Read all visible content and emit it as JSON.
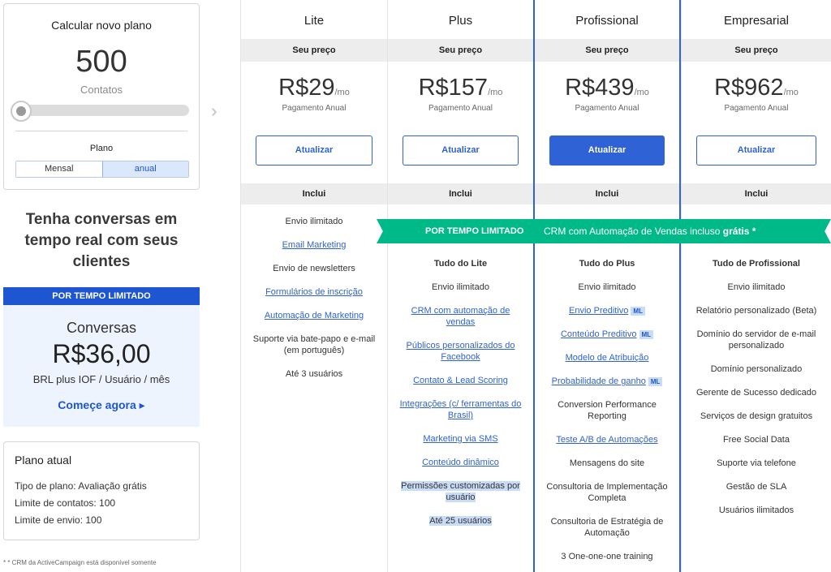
{
  "calculator": {
    "title": "Calcular novo plano",
    "contacts_value": "500",
    "contacts_unit": "Contatos",
    "slider_level": 0,
    "plan_label": "Plano",
    "toggle": {
      "monthly": "Mensal",
      "annual": "anual",
      "selected": "annual"
    }
  },
  "arrow_icon": "double-chevron-right",
  "promo": {
    "heading": "Tenha conversas em tempo real com seus clientes",
    "banner": "POR TEMPO LIMITADO",
    "title": "Conversas",
    "price": "R$36,00",
    "subtitle": "BRL plus IOF / Usuário / mês",
    "cta": "Começe agora ▸"
  },
  "current_plan": {
    "title": "Plano atual",
    "type": "Tipo de plano: Avaliação grátis",
    "contact_limit": "Limite de contatos: 100",
    "send_limit": "Limite de envio: 100"
  },
  "footnote": "* * CRM da ActiveCampaign está disponível somente",
  "ribbon": {
    "tag": "POR TEMPO LIMITADO",
    "text": "CRM com Automação de Vendas incluso ",
    "free": "grátis *",
    "color": "#00b989"
  },
  "colors": {
    "accent": "#2f62d4",
    "ribbon": "#00b989",
    "promo_bg": "#eef4fd"
  },
  "plans": [
    {
      "name": "Lite",
      "price_header": "Seu preço",
      "price": "R$29",
      "period": "/mo",
      "billing": "Pagamento Anual",
      "button": "Atualizar",
      "includes": "Inclui",
      "features": [
        {
          "text": "Envio ilimitado"
        },
        {
          "text": "Email Marketing",
          "link": true
        },
        {
          "text": "Envio de newsletters"
        },
        {
          "text": "Formulários de inscrição",
          "link": true
        },
        {
          "text": "Automação de Marketing",
          "link": true
        },
        {
          "text": "Suporte via bate-papo e e-mail (em português)"
        },
        {
          "text": "Até 3 usuários"
        }
      ]
    },
    {
      "name": "Plus",
      "price_header": "Seu preço",
      "price": "R$157",
      "period": "/mo",
      "billing": "Pagamento Anual",
      "button": "Atualizar",
      "includes": "Inclui",
      "features": [
        {
          "text": "Tudo do Lite",
          "bold": true
        },
        {
          "text": "Envio ilimitado"
        },
        {
          "text": "CRM com automação de vendas",
          "link": true
        },
        {
          "text": "Públicos personalizados do Facebook",
          "link": true
        },
        {
          "text": "Contato & Lead Scoring",
          "link": true
        },
        {
          "text": "Integrações (c/ ferramentas do Brasil)",
          "link": true
        },
        {
          "text": "Marketing via SMS",
          "link": true
        },
        {
          "text": "Conteúdo dinâmico",
          "link": true
        },
        {
          "text": "Permissões customizadas por usuário",
          "highlight": true
        },
        {
          "text": "Até 25 usuários",
          "highlight": true
        }
      ]
    },
    {
      "name": "Profissional",
      "price_header": "Seu preço",
      "price": "R$439",
      "period": "/mo",
      "billing": "Pagamento Anual",
      "button": "Atualizar",
      "includes": "Inclui",
      "features": [
        {
          "text": "Tudo do Plus",
          "bold": true
        },
        {
          "text": "Envio ilimitado"
        },
        {
          "text": "Envio Preditivo",
          "link": true,
          "badge": "ML"
        },
        {
          "text": "Conteúdo Preditivo",
          "link": true,
          "badge": "ML"
        },
        {
          "text": "Modelo de Atribuição",
          "link": true
        },
        {
          "text": "Probabilidade de ganho",
          "link": true,
          "badge": "ML"
        },
        {
          "text": "Conversion Performance Reporting"
        },
        {
          "text": "Teste A/B de Automações",
          "link": true
        },
        {
          "text": "Mensagens do site"
        },
        {
          "text": "Consultoria de Implementação Completa"
        },
        {
          "text": "Consultoria de Estratégia de Automação"
        },
        {
          "text": "3 One-one-one training"
        }
      ]
    },
    {
      "name": "Empresarial",
      "price_header": "Seu preço",
      "price": "R$962",
      "period": "/mo",
      "billing": "Pagamento Anual",
      "button": "Atualizar",
      "includes": "Inclui",
      "features": [
        {
          "text": "Tudo de Profissional",
          "bold": true
        },
        {
          "text": "Envio ilimitado"
        },
        {
          "text": "Relatório personalizado (Beta)"
        },
        {
          "text": "Domínio do servidor de e-mail personalizado"
        },
        {
          "text": "Domínio personalizado"
        },
        {
          "text": "Gerente de Sucesso dedicado"
        },
        {
          "text": "Serviços de design gratuitos"
        },
        {
          "text": "Free Social Data"
        },
        {
          "text": "Suporte via telefone"
        },
        {
          "text": "Gestão de SLA"
        },
        {
          "text": "Usuários ilimitados"
        }
      ]
    }
  ]
}
